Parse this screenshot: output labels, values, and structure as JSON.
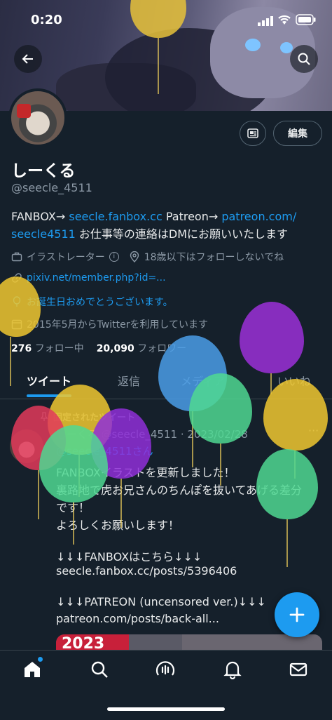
{
  "status_bar": {
    "time": "0:20"
  },
  "profile": {
    "edit_label": "編集",
    "display_name": "しーくる",
    "handle": "@seecle_4511",
    "bio_parts": {
      "p1": "FANBOX→ ",
      "link1": "seecle.fanbox.cc",
      "p2": " Patreon→ ",
      "link2": "patreon.com/",
      "link3": "seecle4511",
      "p3": " お仕事等の連絡はDMにお願いいたします"
    },
    "category": "イラストレーター",
    "location": "18歳以下はフォローしないでね",
    "website": "pixiv.net/member.php?id=...",
    "birthday": "お誕生日おめでとうございます。",
    "joined": "2015年5月からTwitterを利用しています",
    "following_count": "276",
    "following_label": "フォロー中",
    "followers_count": "20,090",
    "followers_label": "フォロワー"
  },
  "tabs": [
    "ツイート",
    "返信",
    "メディア",
    "いいね"
  ],
  "pinned": {
    "pinned_label": "固定されたツイート",
    "author_meta": "しーくる @seecle_4511 · 2023/02/28",
    "reply_to": "@seecle_4511さん",
    "lines": [
      "FANBOXイラストを更新しました！",
      "裏路地で虎お兄さんのちんぽを抜いてあげる差分",
      "です！",
      "よろしくお願いします！",
      "",
      "↓↓↓FANBOXはこちら↓↓↓",
      "seecle.fanbox.cc/posts/5396406",
      "",
      "↓↓↓PATREON (uncensored ver.)↓↓↓",
      "patreon.com/posts/back-all..."
    ],
    "media_text": "2023"
  },
  "fab_icon": "plus-icon",
  "nav": [
    "home-icon",
    "search-icon",
    "spaces-icon",
    "bell-icon",
    "mail-icon"
  ],
  "colors": {
    "accent": "#1d9bf0",
    "background": "#15202b",
    "muted": "#8b98a5"
  }
}
